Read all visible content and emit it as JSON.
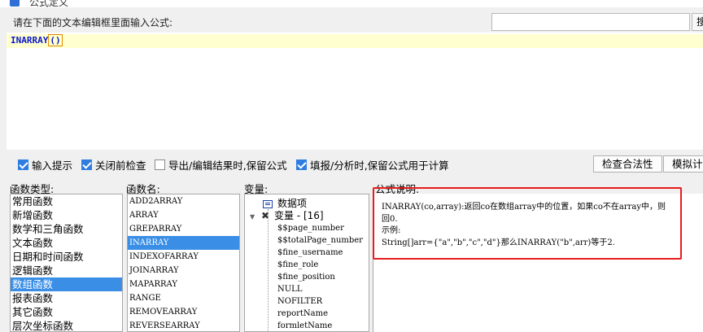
{
  "window": {
    "title": "公式定义"
  },
  "prompt": "请在下面的文本编辑框里面输入公式:",
  "search": {
    "value": "",
    "button_label": "搜"
  },
  "editor": {
    "function_name": "INARRAY",
    "open_paren": "(",
    "close_paren": ")"
  },
  "options": [
    {
      "label": "输入提示",
      "checked": true
    },
    {
      "label": "关闭前检查",
      "checked": true
    },
    {
      "label": "导出/编辑结果时,保留公式",
      "checked": false
    },
    {
      "label": "填报/分析时,保留公式用于计算",
      "checked": true
    }
  ],
  "buttons": {
    "check_validity": "检查合法性",
    "simulate": "模拟计算"
  },
  "labels": {
    "categories": "函数类型:",
    "functions": "函数名:",
    "variables": "变量:",
    "description": "公式说明:"
  },
  "categories": [
    "常用函数",
    "新增函数",
    "数学和三角函数",
    "文本函数",
    "日期和时间函数",
    "逻辑函数",
    "数组函数",
    "报表函数",
    "其它函数",
    "层次坐标函数"
  ],
  "selected_category": "数组函数",
  "functions": [
    "ADD2ARRAY",
    "ARRAY",
    "GREPARRAY",
    "INARRAY",
    "INDEXOFARRAY",
    "JOINARRAY",
    "MAPARRAY",
    "RANGE",
    "REMOVEARRAY",
    "REVERSEARRAY"
  ],
  "selected_function": "INARRAY",
  "variables": {
    "data_items": "数据项",
    "variables_group": "变量 - [16]",
    "items": [
      "$$page_number",
      "$$totalPage_number",
      "$fine_username",
      "$fine_role",
      "$fine_position",
      "NULL",
      "NOFILTER",
      "reportName",
      "formletName"
    ]
  },
  "description": {
    "line1": "INARRAY(co,array):返回co在数组array中的位置，如果co不在array中，则",
    "line2": "回0.",
    "line3": "示例:",
    "line4": "String[]arr={\"a\",\"b\",\"c\",\"d\"}那么INARRAY(\"b\",arr)等于2."
  },
  "colors": {
    "accent": "#3a8ee6",
    "highlight_box": "#e81c1c",
    "editor_line": "#ffffd0",
    "code": "#0a18c8"
  }
}
